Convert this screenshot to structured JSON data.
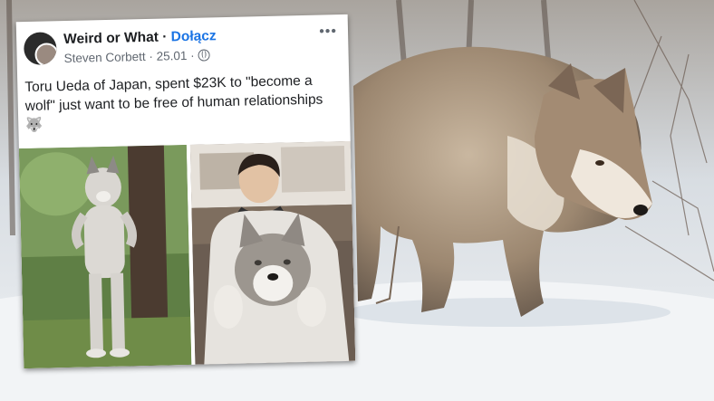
{
  "post": {
    "group_name": "Weird or What",
    "separator": " · ",
    "join_label": "Dołącz",
    "author": "Steven Corbett",
    "date": " · 25.01 · ",
    "more_label": "•••",
    "body_text": "Toru Ueda of Japan, spent $23K to \"become a wolf\" just want to be free of human relationships🐺"
  },
  "icons": [
    "globe-icon",
    "more-options-icon",
    "wolf-emoji-icon"
  ]
}
